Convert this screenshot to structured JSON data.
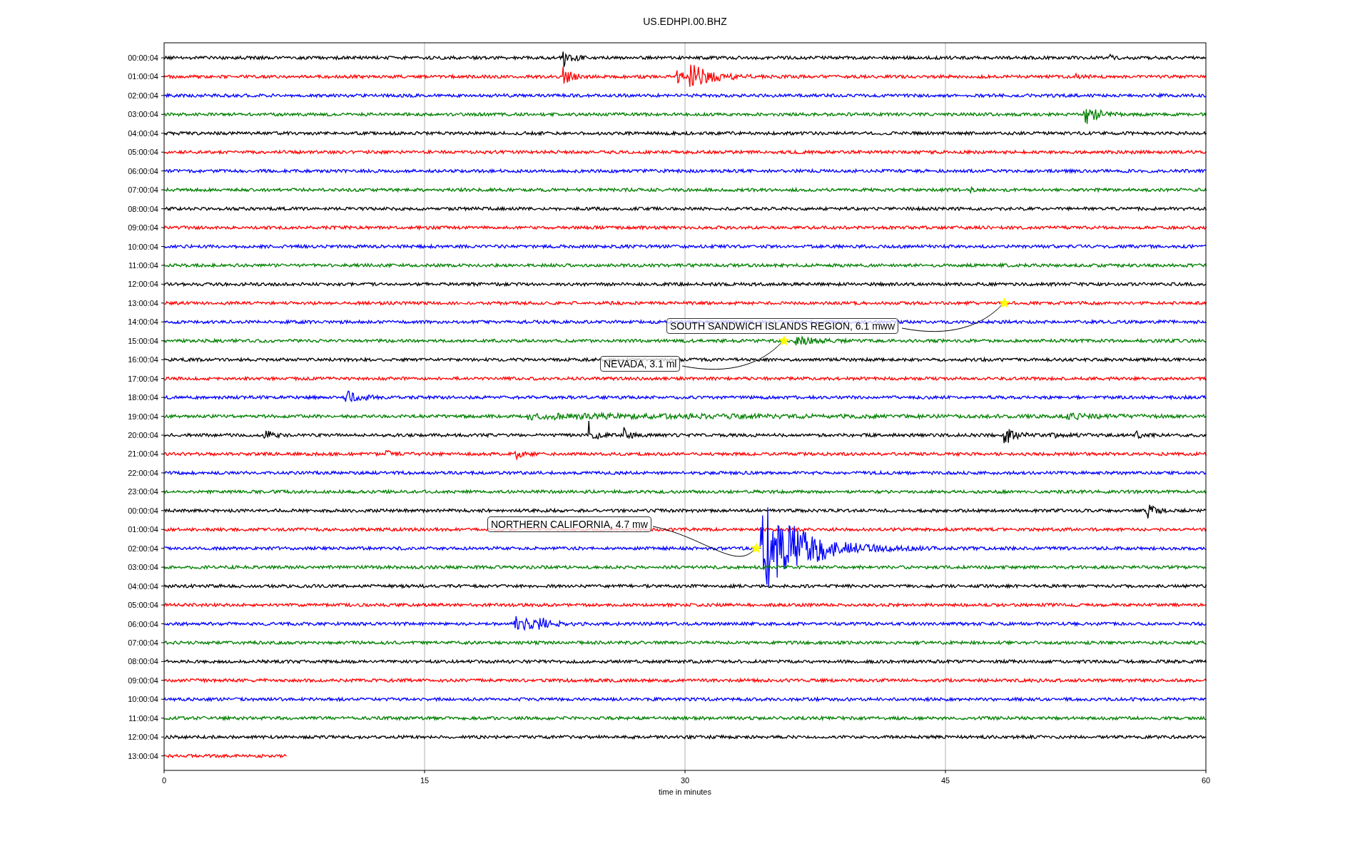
{
  "title": "US.EDHPI.00.BHZ",
  "xlabel": "time in minutes",
  "xticks": [
    "0",
    "15",
    "30",
    "45",
    "60"
  ],
  "rows": [
    {
      "label": "00:00:04",
      "color": "#000000"
    },
    {
      "label": "01:00:04",
      "color": "#ff0000"
    },
    {
      "label": "02:00:04",
      "color": "#0000ff"
    },
    {
      "label": "03:00:04",
      "color": "#008000"
    },
    {
      "label": "04:00:04",
      "color": "#000000"
    },
    {
      "label": "05:00:04",
      "color": "#ff0000"
    },
    {
      "label": "06:00:04",
      "color": "#0000ff"
    },
    {
      "label": "07:00:04",
      "color": "#008000"
    },
    {
      "label": "08:00:04",
      "color": "#000000"
    },
    {
      "label": "09:00:04",
      "color": "#ff0000"
    },
    {
      "label": "10:00:04",
      "color": "#0000ff"
    },
    {
      "label": "11:00:04",
      "color": "#008000"
    },
    {
      "label": "12:00:04",
      "color": "#000000"
    },
    {
      "label": "13:00:04",
      "color": "#ff0000"
    },
    {
      "label": "14:00:04",
      "color": "#0000ff"
    },
    {
      "label": "15:00:04",
      "color": "#008000"
    },
    {
      "label": "16:00:04",
      "color": "#000000"
    },
    {
      "label": "17:00:04",
      "color": "#ff0000"
    },
    {
      "label": "18:00:04",
      "color": "#0000ff"
    },
    {
      "label": "19:00:04",
      "color": "#008000"
    },
    {
      "label": "20:00:04",
      "color": "#000000"
    },
    {
      "label": "21:00:04",
      "color": "#ff0000"
    },
    {
      "label": "22:00:04",
      "color": "#0000ff"
    },
    {
      "label": "23:00:04",
      "color": "#008000"
    },
    {
      "label": "00:00:04",
      "color": "#000000"
    },
    {
      "label": "01:00:04",
      "color": "#ff0000"
    },
    {
      "label": "02:00:04",
      "color": "#0000ff"
    },
    {
      "label": "03:00:04",
      "color": "#008000"
    },
    {
      "label": "04:00:04",
      "color": "#000000"
    },
    {
      "label": "05:00:04",
      "color": "#ff0000"
    },
    {
      "label": "06:00:04",
      "color": "#0000ff"
    },
    {
      "label": "07:00:04",
      "color": "#008000"
    },
    {
      "label": "08:00:04",
      "color": "#000000"
    },
    {
      "label": "09:00:04",
      "color": "#ff0000"
    },
    {
      "label": "10:00:04",
      "color": "#0000ff"
    },
    {
      "label": "11:00:04",
      "color": "#008000"
    },
    {
      "label": "12:00:04",
      "color": "#000000"
    },
    {
      "label": "13:00:04",
      "color": "#ff0000"
    }
  ],
  "events": [
    {
      "label": "SOUTH SANDWICH ISLANDS REGION, 6.1 mww"
    },
    {
      "label": "NEVADA, 3.1 ml"
    },
    {
      "label": "NORTHERN CALIFORNIA, 4.7 mw"
    }
  ]
}
